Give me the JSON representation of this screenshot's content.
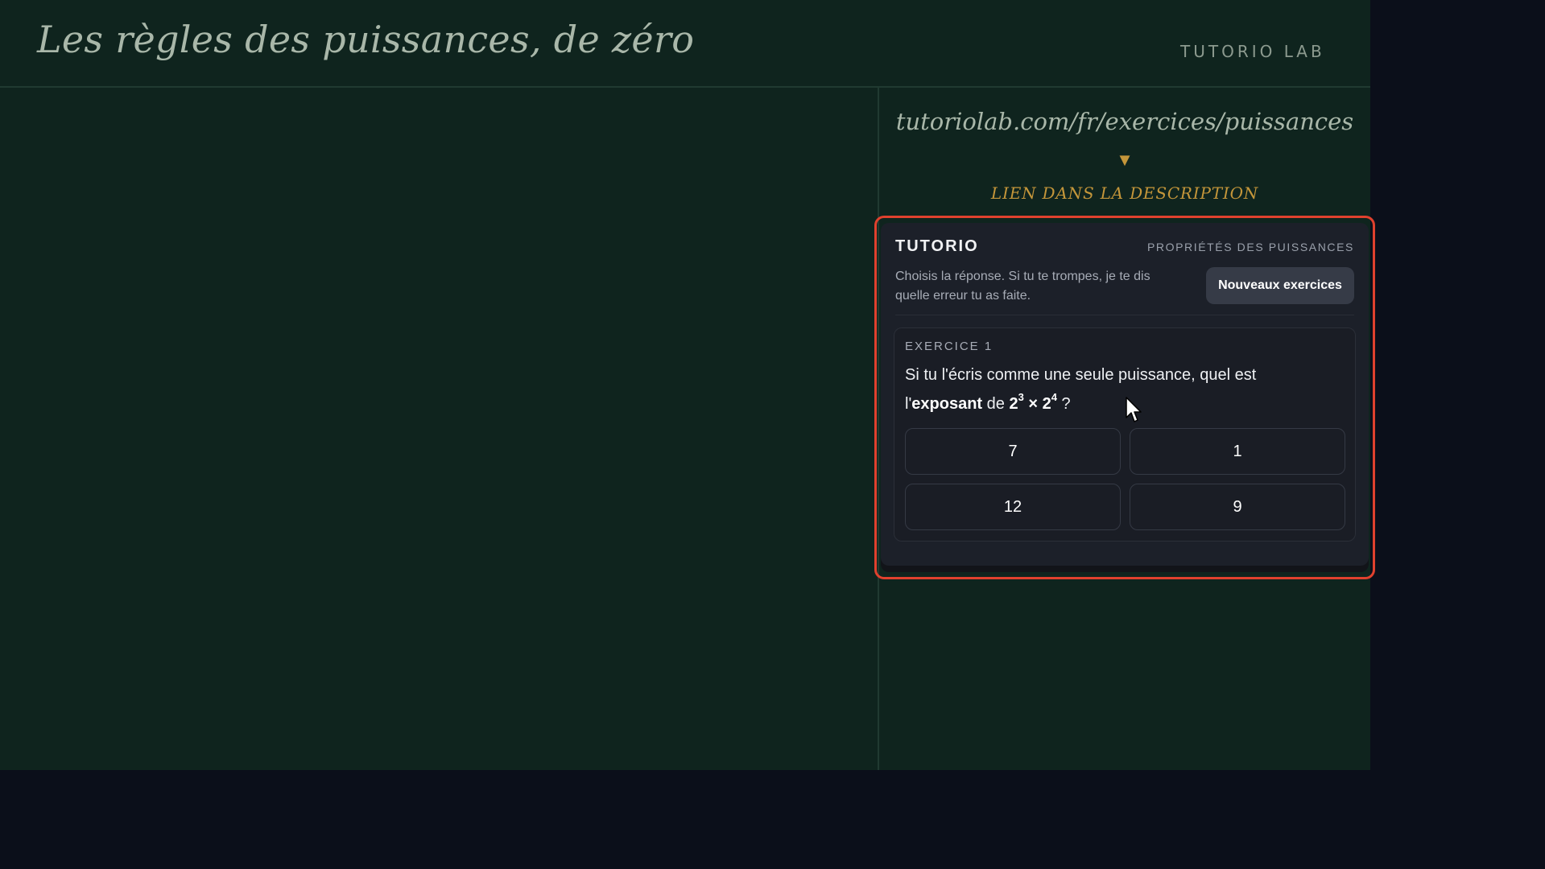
{
  "header": {
    "title": "Les règles des puissances, de zéro",
    "brand": "TUTORIO LAB"
  },
  "promo": {
    "url": "tutoriolab.com/fr/exercices/puissances",
    "arrow": "▼",
    "link_note": "LIEN DANS LA DESCRIPTION"
  },
  "card": {
    "title": "TUTORIO",
    "topic": "PROPRIÉTÉS DES PUISSANCES",
    "description": "Choisis la réponse. Si tu te trompes, je te dis quelle erreur tu as faite.",
    "new_button": "Nouveaux exercices"
  },
  "exercise": {
    "label": "EXERCICE 1",
    "q_prefix": "Si tu l'écris comme une seule puissance, quel est l'",
    "q_bold": "exposant",
    "q_mid": " de ",
    "base1": "2",
    "exp1": "3",
    "operator": " × ",
    "base2": "2",
    "exp2": "4",
    "q_suffix": " ?",
    "answers": [
      "7",
      "1",
      "12",
      "9"
    ]
  },
  "colors": {
    "board": "#0f241e",
    "accent": "#c4963a",
    "highlight": "#e0412e",
    "card": "#1c2029"
  }
}
